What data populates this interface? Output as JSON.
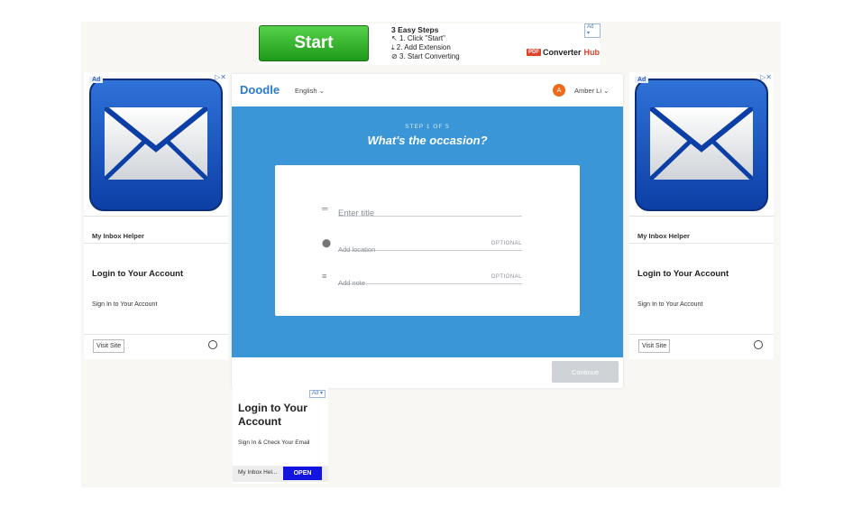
{
  "top_ad": {
    "start_label": "Start",
    "steps_title": "3 Easy Steps",
    "step1": "1. Click \"Start\"",
    "step2": "2. Add Extension",
    "step3": "3. Start Converting",
    "brand_pdf": "PDF",
    "brand_name": "Converter",
    "brand_hub": "Hub",
    "ad_tag": "Ad"
  },
  "side_ad": {
    "ad_label": "Ad",
    "sponsor": "My Inbox Helper",
    "headline": "Login to Your Account",
    "description": "Sign In to Your Account",
    "visit_label": "Visit Site"
  },
  "doodle": {
    "logo": "Doodle",
    "language": "English",
    "avatar_initial": "A",
    "user_name": "Amber Li",
    "step_label": "STEP 1 OF 5",
    "question": "What's the occasion?",
    "title_placeholder": "Enter title",
    "location_placeholder": "Add location",
    "note_placeholder": "Add note",
    "optional_label": "OPTIONAL",
    "continue_label": "Continue"
  },
  "bottom_ad": {
    "ad_tag": "Ad",
    "headline": "Login to Your Account",
    "description": "Sign In & Check Your Email",
    "sponsor": "My Inbox Hel...",
    "open_label": "OPEN"
  }
}
